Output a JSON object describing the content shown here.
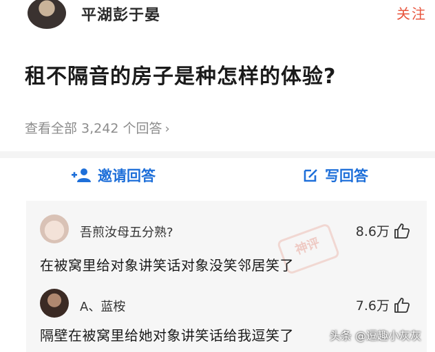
{
  "author": {
    "name": "平湖彭于晏",
    "follow_label": "关注"
  },
  "question": {
    "title": "租不隔音的房子是种怎样的体验?",
    "view_all": "查看全部 3,242 个回答",
    "view_all_chevron": "›"
  },
  "actions": {
    "invite_label": "邀请回答",
    "write_label": "写回答",
    "accent_color": "#1e6fd9"
  },
  "comments": [
    {
      "user": "吾煎汝母五分熟?",
      "likes": "8.6万",
      "text": "在被窝里给对象讲笑话对象没笑邻居笑了"
    },
    {
      "user": "A、蓝桉",
      "likes": "7.6万",
      "text": "隔壁在被窝里给她对象讲笑话给我逗笑了"
    }
  ],
  "stamp_text": "神评",
  "watermark": "头条 @逗趣小灰灰"
}
